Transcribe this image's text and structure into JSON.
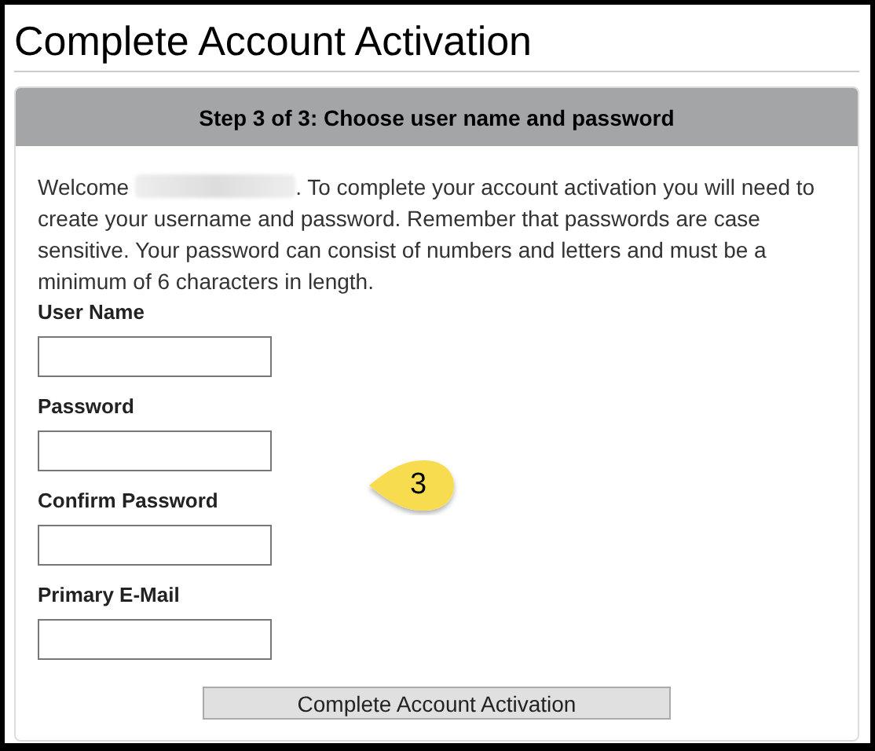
{
  "page_title": "Complete Account Activation",
  "panel": {
    "header": "Step 3 of 3: Choose user name and password",
    "intro_before": "Welcome",
    "intro_after": ". To complete your account activation you will need to create your username and password. Remember that passwords are case sensitive. Your password can consist of numbers and letters and must be a minimum of 6 characters in length.",
    "fields": [
      {
        "label": "User Name"
      },
      {
        "label": "Password"
      },
      {
        "label": "Confirm Password"
      },
      {
        "label": "Primary E-Mail"
      }
    ],
    "submit_button": "Complete Account Activation"
  },
  "callout": "3"
}
